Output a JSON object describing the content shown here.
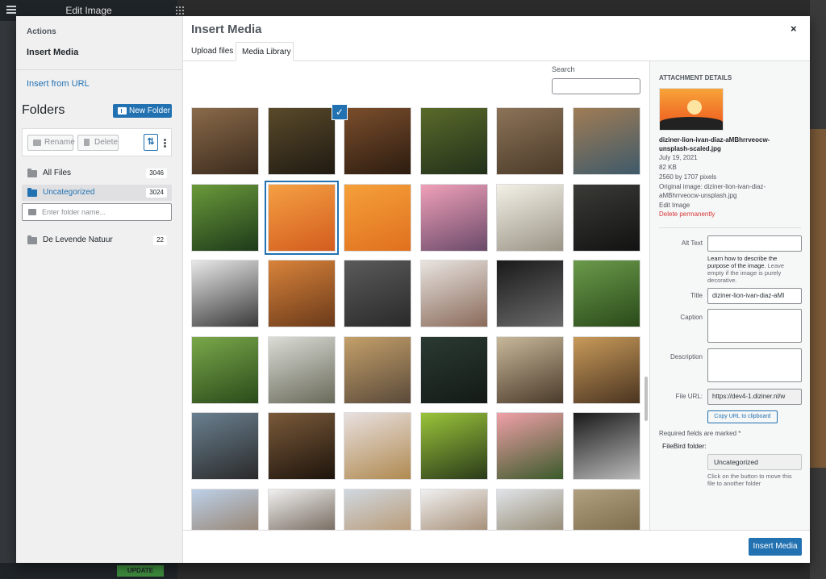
{
  "editor": {
    "title": "Edit Image",
    "update_label": "UPDATE"
  },
  "sidebar": {
    "actions_heading": "Actions",
    "insert_media": "Insert Media",
    "insert_from_url": "Insert from URL",
    "folders_title": "Folders",
    "new_folder_label": "New Folder",
    "rename_label": "Rename",
    "delete_label": "Delete",
    "folder_input_placeholder": "Enter folder name...",
    "folders": [
      {
        "name": "All Files",
        "count": "3046"
      },
      {
        "name": "Uncategorized",
        "count": "3024"
      },
      {
        "name": "De Levende Natuur",
        "count": "22"
      }
    ]
  },
  "modal": {
    "title": "Insert Media",
    "close": "×",
    "tabs": [
      "Upload files",
      "Media Library"
    ],
    "search_label": "Search",
    "insert_button": "Insert Media"
  },
  "grid": {
    "selected_index": 7,
    "tiles": [
      "lioness-resting",
      "leopard-in-grass",
      "wildcat-blur",
      "leopard-grass-green",
      "rhino-closeup",
      "leopard-lying",
      "bamboo-canopy",
      "lion-sunset",
      "elephant-sunset",
      "buffalo-pink-sky",
      "elephant-fog",
      "rhino-dark",
      "buffalo-bw",
      "lions-fighting",
      "elephant-cloudy",
      "lion-rock",
      "elephants-tusks",
      "cheetah-green",
      "cheetah-running",
      "elephants-walking",
      "elephant-family",
      "lion-dark",
      "rhino-grass",
      "bison-grass",
      "buffalo-moody",
      "lion-face",
      "giraffe-neck",
      "bison-green",
      "elephants-pink",
      "elephant-bw",
      "savanna-mountain",
      "leopard-tree",
      "landscape-hills",
      "bison-snow",
      "giraffe-trees",
      "giraffe-woods"
    ]
  },
  "details": {
    "heading": "ATTACHMENT DETAILS",
    "filename": "diziner-lion-ivan-diaz-aMBhrrveocw-unsplash-scaled.jpg",
    "date": "July 19, 2021",
    "size": "82 KB",
    "dimensions": "2560 by 1707 pixels",
    "original_line1": "Original image: diziner-lion-ivan-diaz-",
    "original_line2": "aMBhrrveocw-unsplash.jpg",
    "edit_image": "Edit Image",
    "delete_permanently": "Delete permanently",
    "alt_label": "Alt Text",
    "alt_help_link": "Learn how to describe the purpose of the image.",
    "alt_help_rest": " Leave empty if the image is purely decorative.",
    "title_label": "Title",
    "title_value": "diziner-lion-ivan-diaz-aMI",
    "caption_label": "Caption",
    "description_label": "Description",
    "file_url_label": "File URL:",
    "file_url_value": "https://dev4-1.diziner.nl/w",
    "copy_url": "Copy URL to clipboard",
    "required_note": "Required fields are marked *",
    "filebird_label": "FileBird folder:",
    "filebird_value": "Uncategorized",
    "filebird_help": "Click on the button to move this file to another folder"
  }
}
